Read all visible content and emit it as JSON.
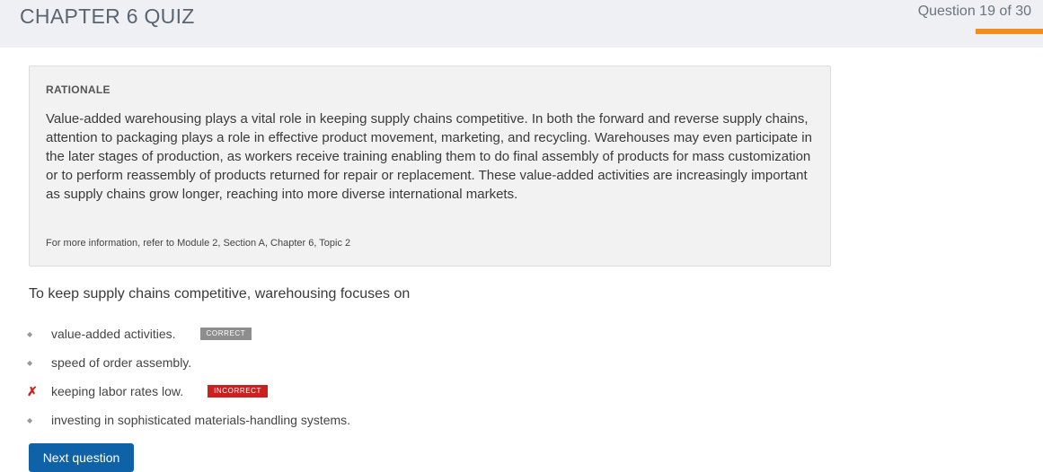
{
  "header": {
    "title": "CHAPTER 6 QUIZ",
    "progress_text": "Question 19 of 30",
    "progress_fraction": 0.633,
    "accent_color": "#f28c1f"
  },
  "rationale": {
    "heading": "RATIONALE",
    "body": "Value-added warehousing plays a vital role in keeping supply chains competitive. In both the forward and reverse supply chains, attention to packaging plays a role in effective product movement, marketing, and recycling. Warehouses may even participate in the later stages of production, as workers receive training enabling them to do final assembly of products for mass customization or to perform reassembly of products returned for repair or replacement. These value-added activities are increasingly important as supply chains grow longer, reaching into more diverse international markets.",
    "reference": "For more information, refer to Module 2, Section A, Chapter 6, Topic 2"
  },
  "question": {
    "text": "To keep supply chains competitive, warehousing focuses on"
  },
  "answers": [
    {
      "text": "value-added activities.",
      "marker": "diamond-icon",
      "badge": "CORRECT"
    },
    {
      "text": "speed of order assembly.",
      "marker": "diamond-icon",
      "badge": ""
    },
    {
      "text": "keeping labor rates low.",
      "marker": "x-icon",
      "badge": "INCORRECT"
    },
    {
      "text": "investing in sophisticated materials-handling systems.",
      "marker": "diamond-icon",
      "badge": ""
    }
  ],
  "actions": {
    "next_label": "Next question",
    "button_color": "#0f62a8"
  }
}
